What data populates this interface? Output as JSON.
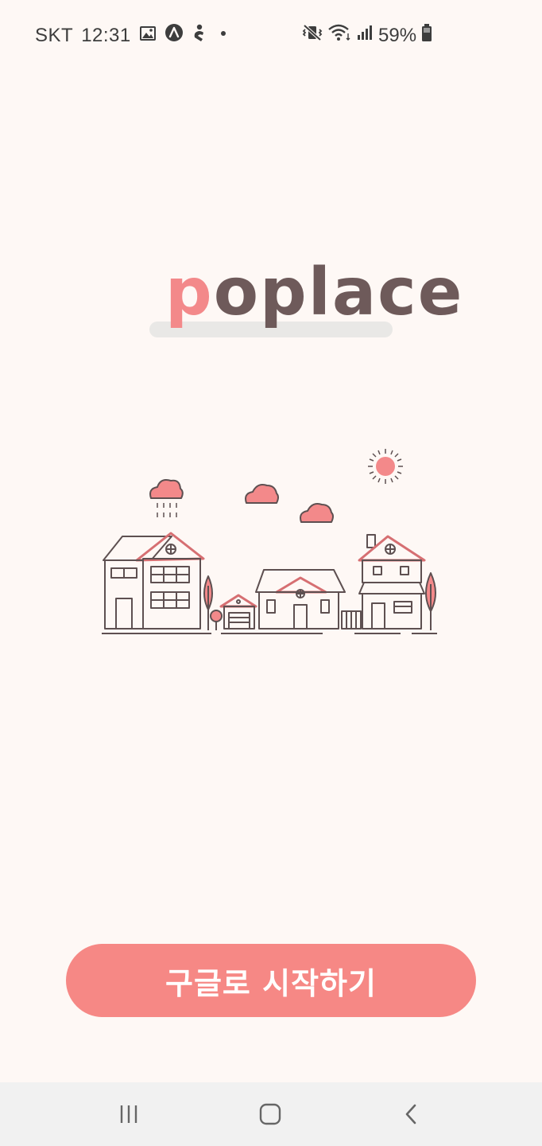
{
  "status_bar": {
    "carrier": "SKT",
    "time": "12:31",
    "battery": "59%",
    "icons": [
      "image-icon",
      "navigation-app-icon",
      "person-app-icon",
      "notification-dot-icon",
      "mute-vibrate-icon",
      "wifi-icon",
      "signal-icon",
      "battery-icon"
    ]
  },
  "logo": {
    "first_letter": "p",
    "rest": "oplace"
  },
  "illustration": {
    "icons": [
      "sun-icon",
      "rain-cloud-icon",
      "cloud-icon",
      "house-icon",
      "tree-icon",
      "garage-icon"
    ]
  },
  "login": {
    "button_label": "구글로 시작하기"
  },
  "nav_bar": {
    "icons": [
      "recent-apps-icon",
      "home-icon",
      "back-icon"
    ]
  },
  "colors": {
    "background": "#FEF8F5",
    "accent": "#F68885",
    "logo_brown": "#6E5A5A",
    "logo_pink": "#F3898A",
    "nav_background": "#F1F1F1"
  }
}
